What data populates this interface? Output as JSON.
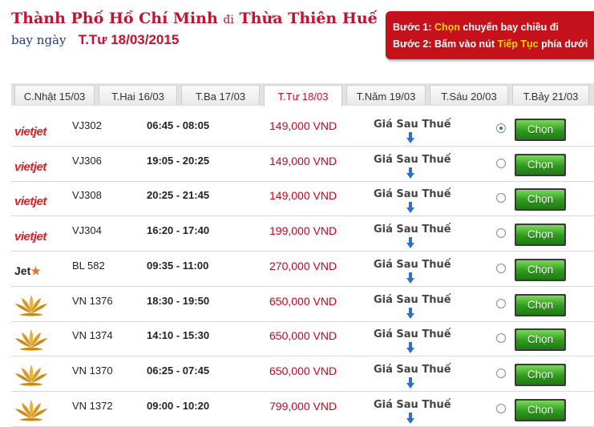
{
  "header": {
    "origin": "Thành Phố Hồ Chí Minh",
    "connector": "đi",
    "destination": "Thừa Thiên Huế",
    "date_label": "bay ngày",
    "date_value": "T.Tư 18/03/2015"
  },
  "instructions": {
    "step1_prefix": "Bước 1: ",
    "step1_highlight": "Chọn",
    "step1_suffix": " chuyến bay chiều đi",
    "step2_prefix": "Bước 2: Bấm vào nút ",
    "step2_highlight": "Tiếp Tục",
    "step2_suffix": " phía dưới"
  },
  "date_tabs": [
    {
      "label": "C.Nhật 15/03",
      "active": false
    },
    {
      "label": "T.Hai 16/03",
      "active": false
    },
    {
      "label": "T.Ba 17/03",
      "active": false
    },
    {
      "label": "T.Tư 18/03",
      "active": true
    },
    {
      "label": "T.Năm 19/03",
      "active": false
    },
    {
      "label": "T.Sáu 20/03",
      "active": false
    },
    {
      "label": "T.Bảy 21/03",
      "active": false
    }
  ],
  "logos": {
    "vietjet": "vietjet",
    "jetstar_text": "Jet",
    "jetstar_star": "★"
  },
  "flights": [
    {
      "airline": "vietjet",
      "number": "VJ302",
      "time": "06:45 - 08:05",
      "price": "149,000 VND",
      "tax_label": "Giá Sau Thuế",
      "button": "Chọn",
      "selected": true
    },
    {
      "airline": "vietjet",
      "number": "VJ306",
      "time": "19:05 - 20:25",
      "price": "149,000 VND",
      "tax_label": "Giá Sau Thuế",
      "button": "Chọn",
      "selected": false
    },
    {
      "airline": "vietjet",
      "number": "VJ308",
      "time": "20:25 - 21:45",
      "price": "149,000 VND",
      "tax_label": "Giá Sau Thuế",
      "button": "Chọn",
      "selected": false
    },
    {
      "airline": "vietjet",
      "number": "VJ304",
      "time": "16:20 - 17:40",
      "price": "199,000 VND",
      "tax_label": "Giá Sau Thuế",
      "button": "Chọn",
      "selected": false
    },
    {
      "airline": "jetstar",
      "number": "BL 582",
      "time": "09:35 - 11:00",
      "price": "270,000 VND",
      "tax_label": "Giá Sau Thuế",
      "button": "Chọn",
      "selected": false
    },
    {
      "airline": "vietnam-airlines",
      "number": "VN 1376",
      "time": "18:30 - 19:50",
      "price": "650,000 VND",
      "tax_label": "Giá Sau Thuế",
      "button": "Chọn",
      "selected": false
    },
    {
      "airline": "vietnam-airlines",
      "number": "VN 1374",
      "time": "14:10 - 15:30",
      "price": "650,000 VND",
      "tax_label": "Giá Sau Thuế",
      "button": "Chọn",
      "selected": false
    },
    {
      "airline": "vietnam-airlines",
      "number": "VN 1370",
      "time": "06:25 - 07:45",
      "price": "650,000 VND",
      "tax_label": "Giá Sau Thuế",
      "button": "Chọn",
      "selected": false
    },
    {
      "airline": "vietnam-airlines",
      "number": "VN 1372",
      "time": "09:00 - 10:20",
      "price": "799,000 VND",
      "tax_label": "Giá Sau Thuế",
      "button": "Chọn",
      "selected": false
    }
  ],
  "colors": {
    "accent_red": "#c8102e",
    "price_red": "#d0021b",
    "button_green": "#2f9a1e",
    "instruction_bg": "#c4111b",
    "highlight_yellow": "#ffd200",
    "arrow_blue": "#2f6fcf"
  },
  "icons": {
    "expand_arrow": "arrow-down-icon",
    "vna_logo": "lotus-icon"
  }
}
